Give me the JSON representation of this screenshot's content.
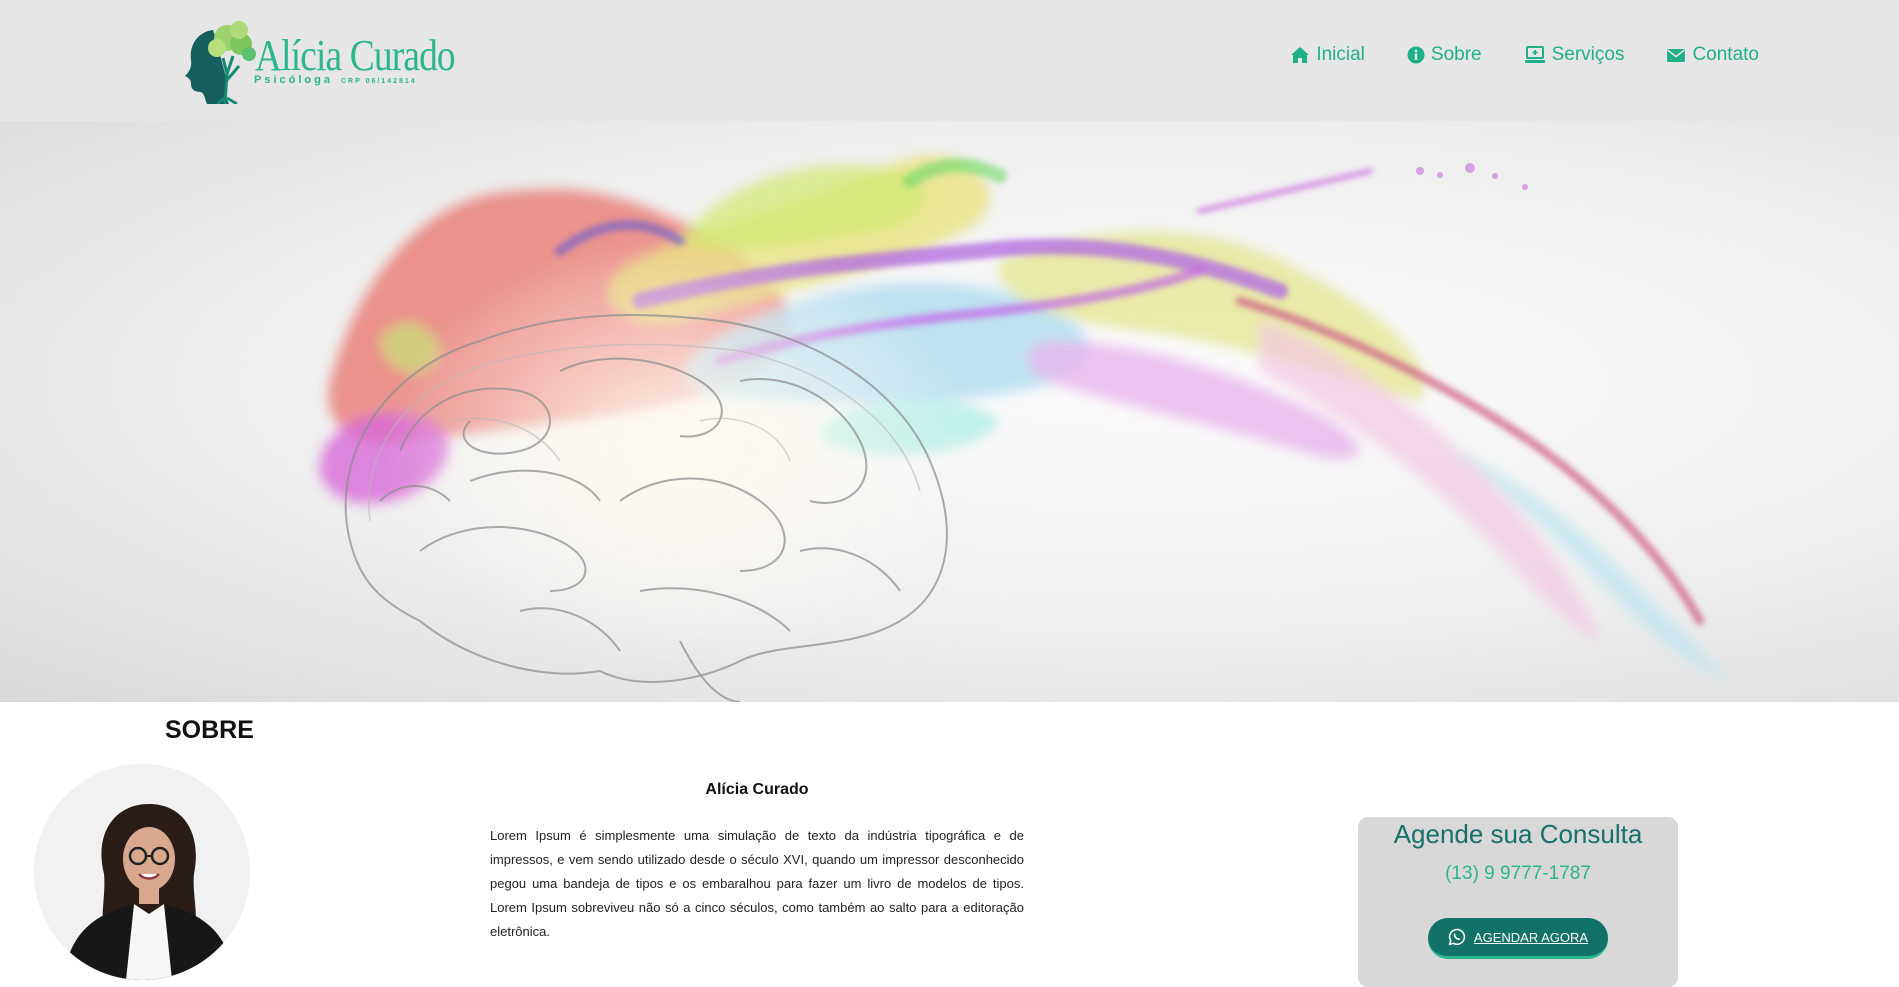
{
  "header": {
    "logo": {
      "name": "Alícia Curado",
      "subtitle": "Psicóloga",
      "crp": "CRP 06/142814"
    },
    "nav": [
      {
        "label": "Inicial",
        "icon": "home-icon"
      },
      {
        "label": "Sobre",
        "icon": "info-icon"
      },
      {
        "label": "Serviços",
        "icon": "laptop-icon"
      },
      {
        "label": "Contato",
        "icon": "envelope-icon"
      }
    ]
  },
  "hero": {
    "image": "brain-with-colorful-paint-splash"
  },
  "about": {
    "title": "SOBRE",
    "name": "Alícia Curado",
    "text": "Lorem Ipsum é simplesmente uma simulação de texto da indústria tipográfica e de impressos, e vem sendo utilizado desde o século XVI, quando um impressor desconhecido pegou uma bandeja de tipos e os embaralhou para fazer um livro de modelos de tipos. Lorem Ipsum sobreviveu não só a cinco séculos, como também ao salto para a editoração eletrônica."
  },
  "cta": {
    "title": "Agende sua Consulta",
    "phone": "(13) 9 9777-1787",
    "button_label": "AGENDAR AGORA",
    "button_icon": "whatsapp-icon"
  },
  "colors": {
    "accent": "#20b089",
    "dark_teal": "#17706a",
    "button": "#127268",
    "header_bg": "#e6e6e6",
    "cta_bg": "#d8d8d8"
  }
}
